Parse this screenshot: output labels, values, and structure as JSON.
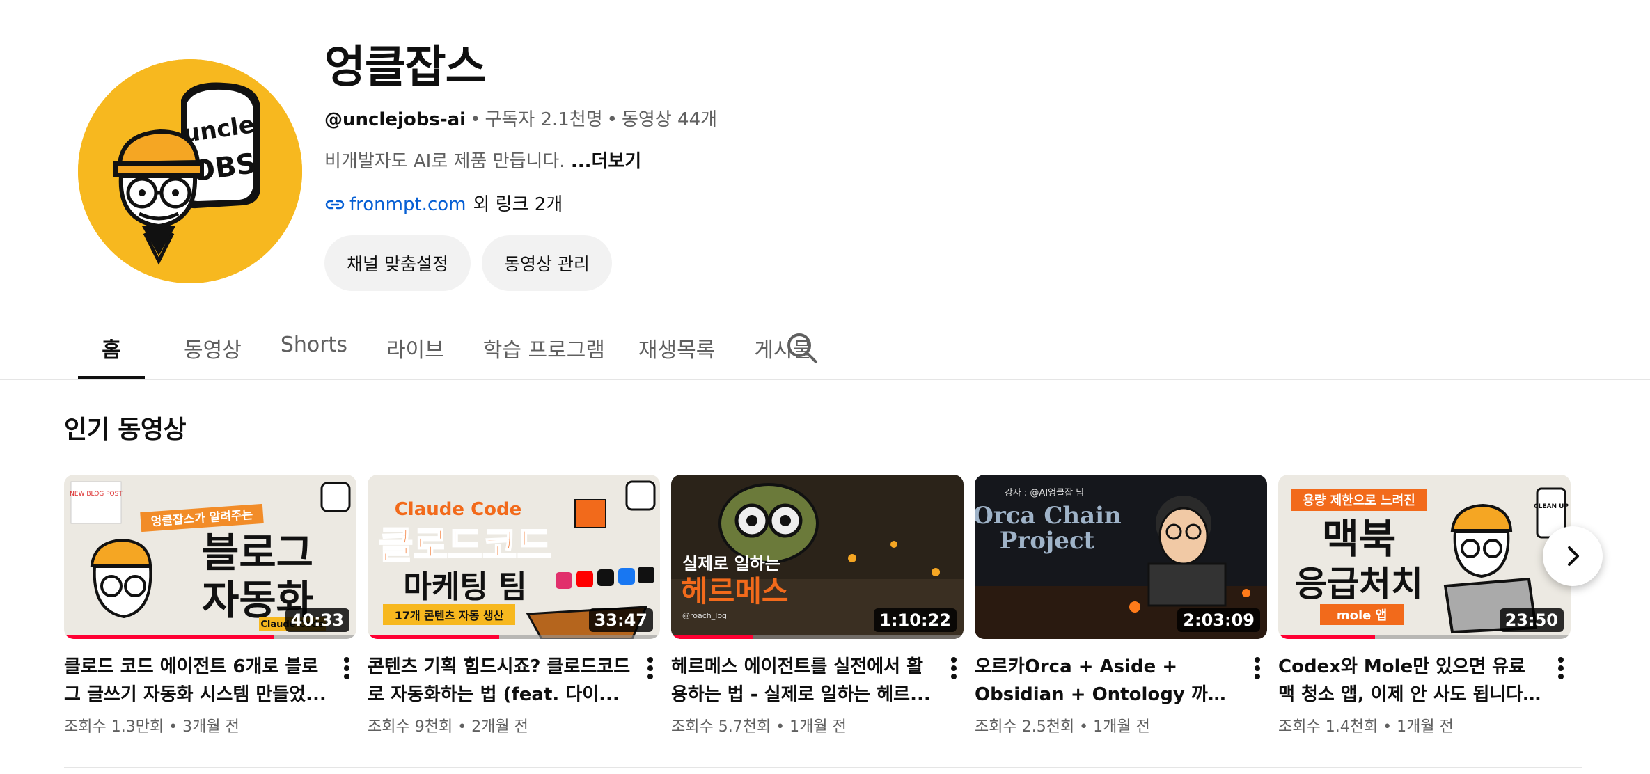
{
  "channel": {
    "name": "엉클잡스",
    "handle": "@unclejobs-ai",
    "subscribers": "구독자 2.1천명",
    "video_count": "동영상 44개",
    "description": "비개발자도 AI로 제품 만듭니다.",
    "more_label": "...더보기",
    "link_text": "fronmpt.com",
    "link_extra": "외 링크 2개",
    "avatar_icon": "unclejobs-logo",
    "avatar_text_top": "uncle",
    "avatar_text_bottom": "JOBS"
  },
  "actions": {
    "customize_label": "채널 맞춤설정",
    "manage_label": "동영상 관리"
  },
  "tabs": [
    {
      "label": "홈",
      "active": true
    },
    {
      "label": "동영상",
      "active": false
    },
    {
      "label": "Shorts",
      "active": false
    },
    {
      "label": "라이브",
      "active": false
    },
    {
      "label": "학습 프로그램",
      "active": false
    },
    {
      "label": "재생목록",
      "active": false
    },
    {
      "label": "게시물",
      "active": false
    }
  ],
  "section": {
    "title": "인기 동영상"
  },
  "videos": [
    {
      "title": "클로드 코드 에이전트 6개로 블로그 글쓰기 자동화 시스템 만들었...",
      "views": "조회수 1.3만회",
      "age": "3개월 전",
      "duration": "40:33",
      "watched": 0.72,
      "thumb": {
        "line1": "블로그",
        "line2": "자동화",
        "tag": "엉클잡스가 알려주는",
        "sub": "Claude Code",
        "corner": "NEW BLOG POST"
      }
    },
    {
      "title": "콘텐츠 기획 힘드시죠? 클로드코드로 자동화하는 법 (feat. 다이...",
      "views": "조회수 9천회",
      "age": "2개월 전",
      "duration": "33:47",
      "watched": 0.45,
      "thumb": {
        "line1": "Claude Code",
        "line2": "클로드코드",
        "line3": "마케팅 팀",
        "sub": "17개 콘텐츠 자동 생산"
      }
    },
    {
      "title": "헤르메스 에이전트를 실전에서 활용하는 법 - 실제로 일하는 헤르...",
      "views": "조회수 5.7천회",
      "age": "1개월 전",
      "duration": "1:10:22",
      "watched": 0.28,
      "thumb": {
        "line1": "실제로 일하는",
        "line2": "헤르메스",
        "sub": "@roach_log"
      }
    },
    {
      "title": "오르카Orca + Aside + Obsidian + Ontology 까지 통합 Grok ...",
      "views": "조회수 2.5천회",
      "age": "1개월 전",
      "duration": "2:03:09",
      "watched": 0,
      "thumb": {
        "line1": "Orca Chain",
        "line2": "Project",
        "tag": "강사 : @AI엉클잡 님"
      }
    },
    {
      "title": "Codex와 Mole만 있으면 유료 맥 청소 앱, 이제 안 사도 됩니다. 맥...",
      "views": "조회수 1.4천회",
      "age": "1개월 전",
      "duration": "23:50",
      "watched": 0.33,
      "thumb": {
        "line1": "맥북",
        "line2": "응급처치",
        "tag": "용량 제한으로 느려진",
        "sub": "mole 앱",
        "badge": "CLEAN UP"
      }
    }
  ],
  "icons": {
    "search": "search-icon",
    "link": "link-icon",
    "next": "chevron-right-icon",
    "kebab": "more-vert-icon"
  },
  "colors": {
    "accent_red": "#ff0033",
    "link_blue": "#065fd4",
    "avatar_yellow": "#f7b81f"
  }
}
